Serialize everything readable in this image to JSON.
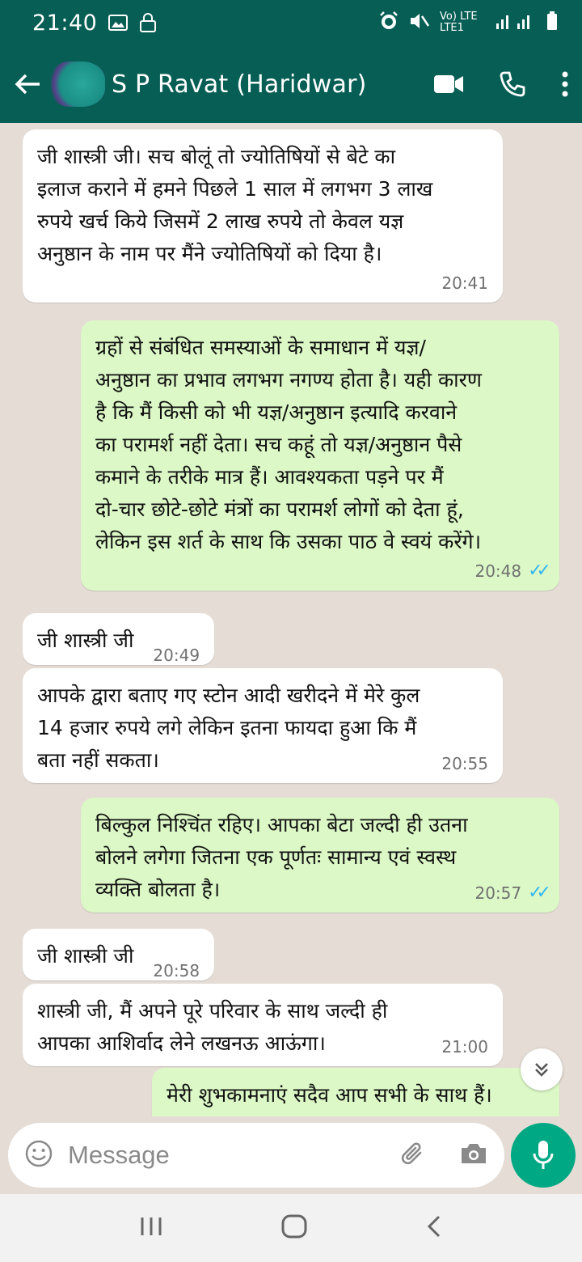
{
  "status_bar": {
    "time": "21:40",
    "network": "Vo) LTE LTE1"
  },
  "header": {
    "contact_name": "S P Ravat (Haridwar)",
    "accent_color": "#075e54"
  },
  "messages": [
    {
      "direction": "in",
      "text": "जी शास्त्री जी। सच बोलूं तो ज्योतिषियों से बेटे का\nइलाज कराने में हमने पिछले 1 साल में लगभग 3 लाख\nरुपये खर्च किये जिसमें 2 लाख रुपये तो केवल यज्ञ\nअनुष्ठान के नाम पर मैंने ज्योतिषियों को दिया है।",
      "time": "20:41"
    },
    {
      "direction": "out",
      "text": "ग्रहों से संबंधित समस्याओं के समाधान में यज्ञ/\nअनुष्ठान का प्रभाव लगभग नगण्य होता है। यही कारण\nहै कि मैं किसी को भी यज्ञ/अनुष्ठान इत्यादि करवाने\nका परामर्श नहीं देता। सच कहूं तो यज्ञ/अनुष्ठान पैसे\nकमाने के तरीके मात्र हैं। आवश्यकता पड़ने पर मैं\nदो-चार छोटे-छोटे मंत्रों का परामर्श लोगों को देता हूं,\nलेकिन इस शर्त के साथ कि उसका पाठ वे स्वयं करेंगे।",
      "time": "20:48",
      "read": true
    },
    {
      "direction": "in",
      "text": "जी शास्त्री जी",
      "time": "20:49"
    },
    {
      "direction": "in",
      "text": "आपके द्वारा बताए गए स्टोन आदी खरीदने में मेरे कुल\n14 हजार रुपये लगे लेकिन इतना फायदा हुआ कि मैं\nबता नहीं सकता।",
      "time": "20:55"
    },
    {
      "direction": "out",
      "text": "बिल्कुल निश्चिंत रहिए। आपका बेटा जल्दी ही उतना\nबोलने लगेगा जितना एक पूर्णतः सामान्य एवं स्वस्थ\nव्यक्ति बोलता है।",
      "time": "20:57",
      "read": true
    },
    {
      "direction": "in",
      "text": "जी शास्त्री जी",
      "time": "20:58"
    },
    {
      "direction": "in",
      "text": "शास्त्री जी, मैं अपने पूरे परिवार के साथ जल्दी ही\nआपका आशिर्वाद लेने लखनऊ आऊंगा।",
      "time": "21:00"
    },
    {
      "direction": "out",
      "text": "मेरी शुभकामनाएं सदैव आप सभी के साथ हैं।",
      "time": "",
      "read": false
    }
  ],
  "input": {
    "placeholder": "Message"
  },
  "colors": {
    "incoming_bubble": "#ffffff",
    "outgoing_bubble": "#dcf8c6",
    "chat_background": "#e5ddd5",
    "read_ticks": "#34b7f1",
    "mic_button": "#00a884"
  },
  "icons": {
    "back": "arrow-left-icon",
    "video": "video-camera-icon",
    "call": "phone-icon",
    "menu": "more-vertical-icon",
    "emoji": "emoji-icon",
    "attach": "paperclip-icon",
    "camera": "camera-icon",
    "mic": "microphone-icon",
    "scroll": "double-chevron-down-icon"
  }
}
